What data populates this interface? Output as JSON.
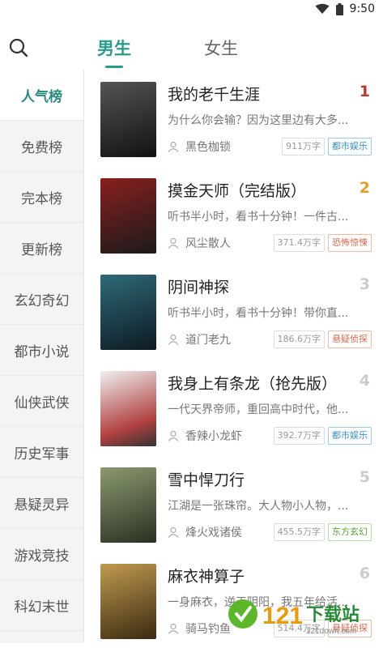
{
  "status": {
    "time": "9:50"
  },
  "tabs": [
    "男生",
    "女生"
  ],
  "sidebar": [
    "人气榜",
    "免费榜",
    "完本榜",
    "更新榜",
    "玄幻奇幻",
    "都市小说",
    "仙侠武侠",
    "历史军事",
    "悬疑灵异",
    "游戏竞技",
    "科幻末世"
  ],
  "books": [
    {
      "title": "我的老千生涯",
      "rank": "1",
      "desc": "为什么你会输？因为这里边有大多...",
      "author": "黑色枷锁",
      "words": "911万字",
      "category": "都市娱乐",
      "cat_style": "blue",
      "rank_color": "#c0392b",
      "cover_color": "#2b2b2b"
    },
    {
      "title": "摸金天师（完结版）",
      "rank": "2",
      "desc": "听书半小时，看书十分钟！一件古...",
      "author": "风尘散人",
      "words": "371.4万字",
      "category": "恐怖惊悚",
      "cat_style": "red",
      "rank_color": "#e0a030",
      "cover_color": "#5a1a1a"
    },
    {
      "title": "阴间神探",
      "rank": "3",
      "desc": "听书半小时，看书十分钟！带你直...",
      "author": "道门老九",
      "words": "186.6万字",
      "category": "悬疑侦探",
      "cat_style": "red",
      "rank_color": "#cccccc",
      "cover_color": "#1c3a44"
    },
    {
      "title": "我身上有条龙（抢先版）",
      "rank": "4",
      "desc": "一代天界帝师，重回高中时代，他...",
      "author": "香辣小龙虾",
      "words": "392.7万字",
      "category": "都市娱乐",
      "cat_style": "blue",
      "rank_color": "#cccccc",
      "cover_color": "#e8e8e8"
    },
    {
      "title": "雪中悍刀行",
      "rank": "5",
      "desc": "江湖是一张珠帘。大人物小人物，...",
      "author": "烽火戏诸侯",
      "words": "455.5万字",
      "category": "东方玄幻",
      "cat_style": "green",
      "rank_color": "#cccccc",
      "cover_color": "#4a5a3a"
    },
    {
      "title": "麻衣神算子",
      "rank": "6",
      "desc": "一身麻衣，逆天阴阳，我五年给活...",
      "author": "骑马钓鱼",
      "words": "514.4万字",
      "category": "悬疑侦探",
      "cat_style": "red",
      "rank_color": "#cccccc",
      "cover_color": "#6a5a30"
    }
  ],
  "watermark": {
    "number": "121",
    "text": "下载站",
    "url": "121down.com"
  }
}
